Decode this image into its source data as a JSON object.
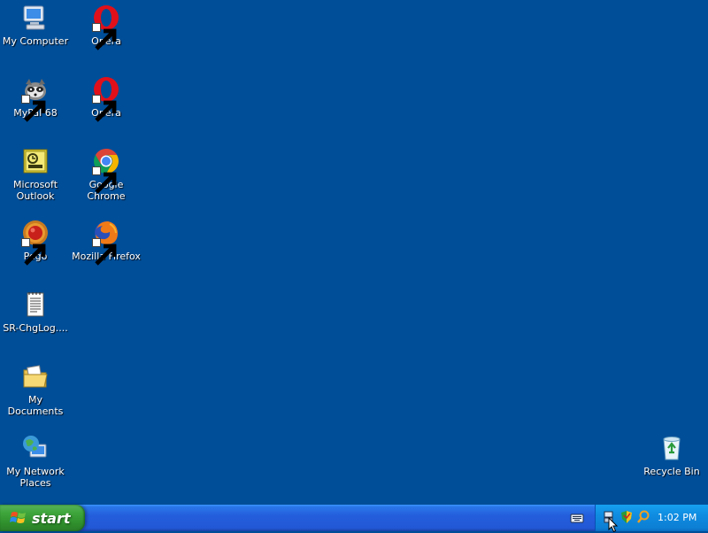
{
  "desktop": {
    "icons": {
      "my_computer": "My Computer",
      "opera_1": "Opera",
      "mypal": "MyPal 68",
      "opera_2": "Opera",
      "outlook": "Microsoft Outlook",
      "chrome": "Google Chrome",
      "pego": "Pego",
      "firefox": "Mozilla Firefox",
      "changelog": "SR-ChgLog....",
      "my_documents": "My Documents",
      "network": "My Network Places",
      "recycle_bin": "Recycle Bin"
    }
  },
  "taskbar": {
    "start_label": "start",
    "clock": "1:02 PM"
  },
  "colors": {
    "desktop": "#004e98",
    "taskbar": "#245edc",
    "start": "#3fa63c",
    "tray": "#0f8be0"
  }
}
